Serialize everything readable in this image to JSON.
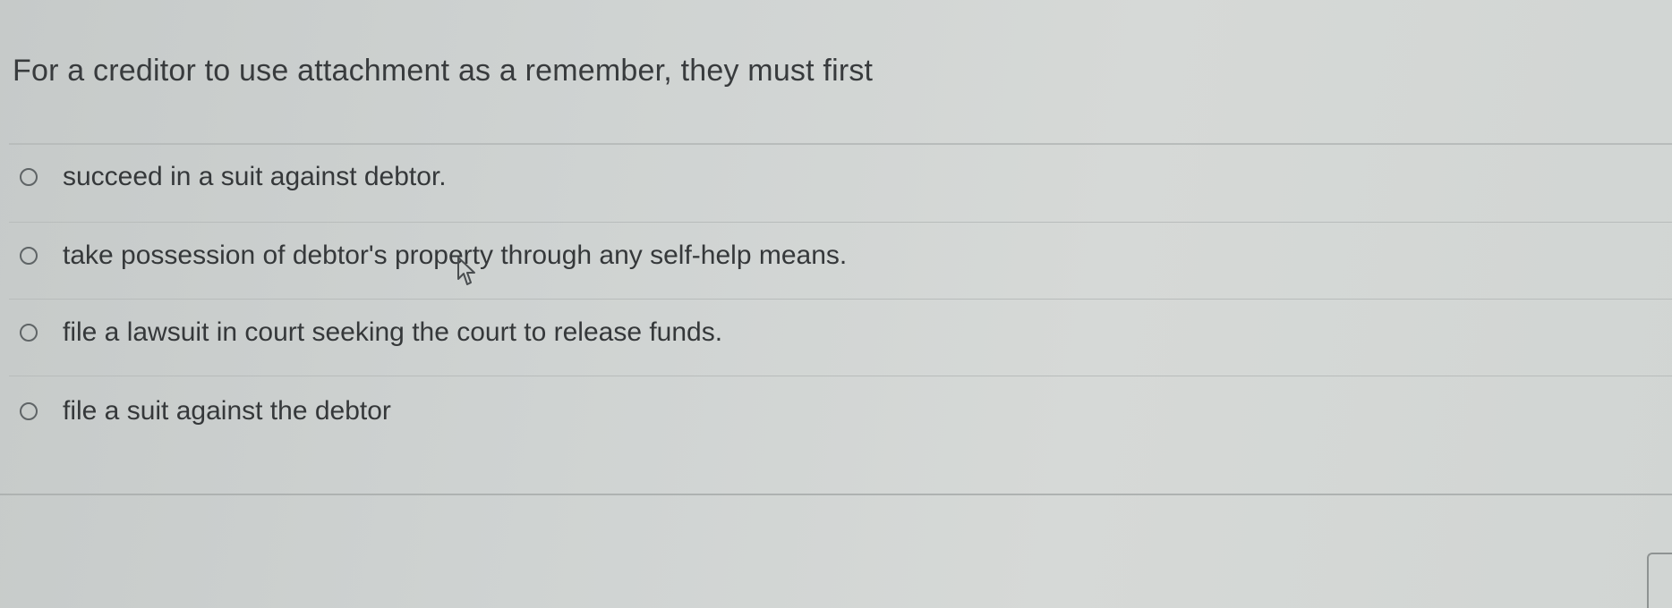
{
  "question": {
    "text": "For a creditor to use attachment as a remember, they must first"
  },
  "options": [
    {
      "label": "succeed in a suit against debtor.",
      "selected": false
    },
    {
      "label": "take possession of debtor's property through any self-help means.",
      "selected": false
    },
    {
      "label": "file a lawsuit in court seeking the court to release funds.",
      "selected": false
    },
    {
      "label": "file a suit against the debtor",
      "selected": false
    }
  ],
  "icons": {
    "radio": "radio-button-icon",
    "cursor": "mouse-pointer-icon"
  },
  "colors": {
    "background": "#d0d4d2",
    "text": "#383b3d",
    "divider": "#b8bcbb"
  }
}
